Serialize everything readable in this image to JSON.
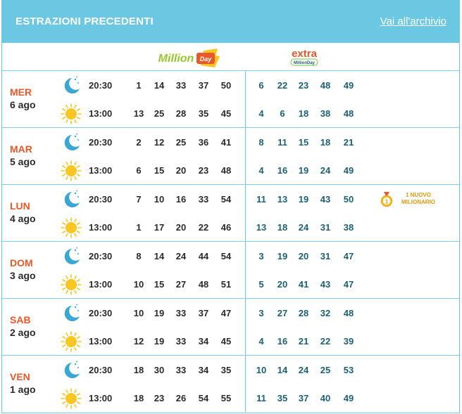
{
  "header": {
    "title": "ESTRAZIONI PRECEDENTI",
    "archive_link": "Vai all'archivio"
  },
  "logos": {
    "millionday": "Million Day",
    "extra_main": "extra",
    "extra_sub": "MillionDay"
  },
  "colors": {
    "header_bg": "#6cc8e2",
    "day_name": "#e8582a",
    "extra_numbers": "#1d6072",
    "sun": "#fac622",
    "moon": "#3aa6d4",
    "badge": "#e09a16"
  },
  "icons": {
    "evening": "moon-stars-icon",
    "midday": "sun-icon",
    "badge": "medal-icon"
  },
  "days": [
    {
      "day": "MER",
      "date": "6 ago",
      "draws": [
        {
          "time": "20:30",
          "main": [
            1,
            14,
            33,
            37,
            50
          ],
          "extra": [
            6,
            22,
            23,
            48,
            49
          ]
        },
        {
          "time": "13:00",
          "main": [
            13,
            25,
            28,
            35,
            45
          ],
          "extra": [
            4,
            6,
            18,
            38,
            48
          ]
        }
      ]
    },
    {
      "day": "MAR",
      "date": "5 ago",
      "draws": [
        {
          "time": "20:30",
          "main": [
            2,
            12,
            25,
            36,
            41
          ],
          "extra": [
            8,
            11,
            15,
            18,
            21
          ]
        },
        {
          "time": "13:00",
          "main": [
            6,
            15,
            20,
            23,
            48
          ],
          "extra": [
            4,
            16,
            19,
            24,
            49
          ]
        }
      ]
    },
    {
      "day": "LUN",
      "date": "4 ago",
      "draws": [
        {
          "time": "20:30",
          "main": [
            7,
            10,
            16,
            33,
            54
          ],
          "extra": [
            11,
            13,
            19,
            43,
            50
          ]
        },
        {
          "time": "13:00",
          "main": [
            1,
            17,
            20,
            22,
            46
          ],
          "extra": [
            13,
            18,
            24,
            31,
            38
          ]
        }
      ]
    },
    {
      "day": "DOM",
      "date": "3 ago",
      "draws": [
        {
          "time": "20:30",
          "main": [
            8,
            14,
            24,
            44,
            54
          ],
          "extra": [
            3,
            19,
            20,
            31,
            47
          ]
        },
        {
          "time": "13:00",
          "main": [
            10,
            15,
            27,
            48,
            51
          ],
          "extra": [
            5,
            20,
            41,
            43,
            47
          ]
        }
      ]
    },
    {
      "day": "SAB",
      "date": "2 ago",
      "draws": [
        {
          "time": "20:30",
          "main": [
            10,
            19,
            33,
            37,
            47
          ],
          "extra": [
            3,
            27,
            28,
            32,
            48
          ]
        },
        {
          "time": "13:00",
          "main": [
            12,
            19,
            33,
            34,
            45
          ],
          "extra": [
            4,
            16,
            21,
            22,
            39
          ]
        }
      ]
    },
    {
      "day": "VEN",
      "date": "1 ago",
      "draws": [
        {
          "time": "20:30",
          "main": [
            18,
            30,
            33,
            34,
            35
          ],
          "extra": [
            10,
            14,
            24,
            25,
            53
          ]
        },
        {
          "time": "13:00",
          "main": [
            18,
            23,
            26,
            54,
            55
          ],
          "extra": [
            11,
            35,
            37,
            40,
            49
          ]
        }
      ]
    }
  ],
  "badge": {
    "count": "1",
    "line1": "1 NUOVO",
    "line2": "MILIONARIO"
  }
}
